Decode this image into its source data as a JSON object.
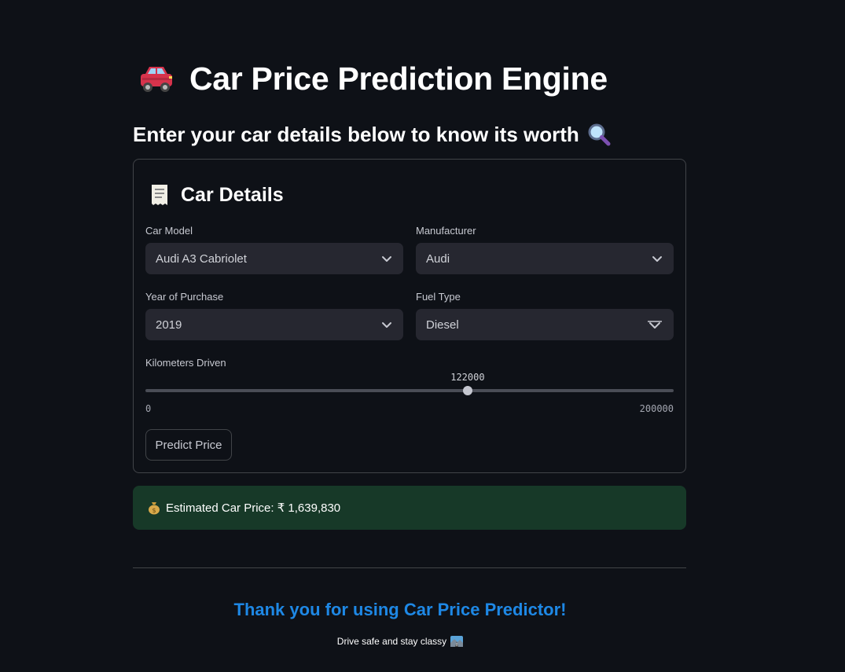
{
  "header": {
    "title": "Car Price Prediction Engine",
    "subtitle": "Enter your car details below to know its worth",
    "title_icon": "car-emoji-icon",
    "subtitle_icon": "magnifying-glass-icon"
  },
  "form": {
    "title": "Car Details",
    "title_icon": "receipt-icon",
    "fields": {
      "car_model": {
        "label": "Car Model",
        "value": "Audi A3 Cabriolet"
      },
      "manufacturer": {
        "label": "Manufacturer",
        "value": "Audi"
      },
      "year": {
        "label": "Year of Purchase",
        "value": "2019"
      },
      "fuel": {
        "label": "Fuel Type",
        "value": "Diesel"
      }
    },
    "slider": {
      "label": "Kilometers Driven",
      "value": 122000,
      "value_text": "122000",
      "min": 0,
      "min_text": "0",
      "max": 200000,
      "max_text": "200000"
    },
    "predict_button": "Predict Price"
  },
  "result": {
    "icon": "money-bag-icon",
    "text": "Estimated Car Price: ₹ 1,639,830",
    "background": "#173928"
  },
  "footer": {
    "thanks": "Thank you for using Car Price Predictor!",
    "tagline": "Drive safe and stay classy",
    "tagline_icon": "road-scene-icon",
    "accent": "#1e88e5"
  }
}
